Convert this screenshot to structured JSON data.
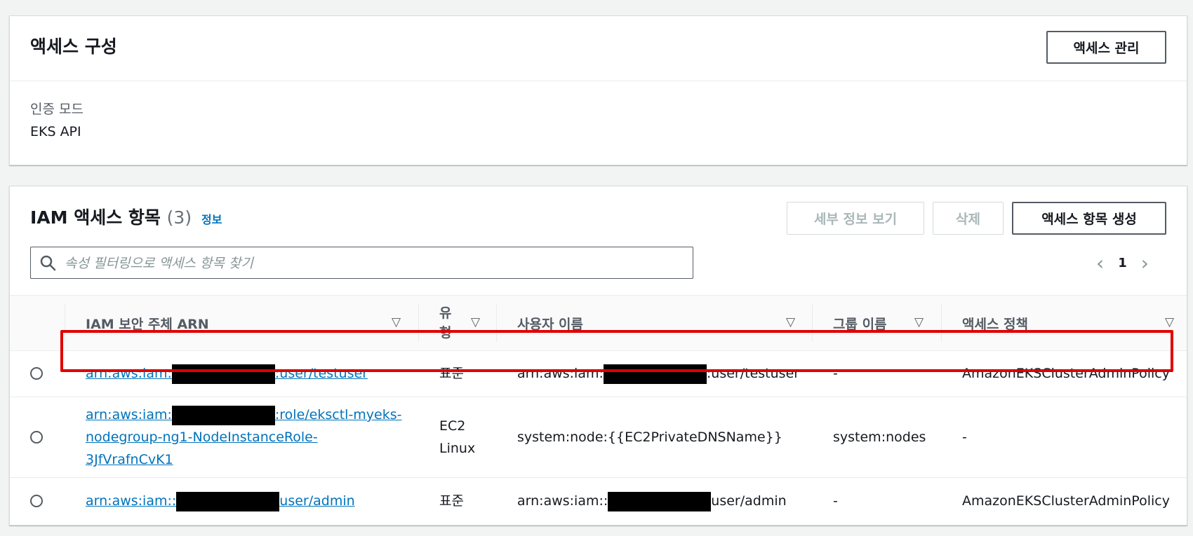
{
  "access_config": {
    "title": "액세스 구성",
    "manage_button": "액세스 관리",
    "auth_mode_label": "인증 모드",
    "auth_mode_value": "EKS API"
  },
  "iam_entries": {
    "title": "IAM 액세스 항목",
    "count": "(3)",
    "info_link": "정보",
    "buttons": {
      "details": "세부 정보 보기",
      "delete": "삭제",
      "create": "액세스 항목 생성"
    },
    "search": {
      "placeholder": "속성 필터링으로 액세스 항목 찾기"
    },
    "pagination": {
      "current_page": "1"
    },
    "columns": {
      "arn": "IAM 보안 주체 ARN",
      "type_line1": "유",
      "type_line2": "형",
      "username": "사용자 이름",
      "group": "그룹 이름",
      "policy": "액세스 정책"
    },
    "rows": [
      {
        "arn_prefix": "arn:aws:iam:",
        "arn_suffix": ":user/testuser",
        "type": "표준",
        "username_prefix": "arn:aws:iam:",
        "username_suffix": ":user/testuser",
        "group": "-",
        "policy": "AmazonEKSClusterAdminPolicy"
      },
      {
        "arn_prefix": "arn:aws:iam:",
        "arn_line1_suffix": ":role/eksctl-myeks-",
        "arn_line2": "nodegroup-ng1-NodeInstanceRole-",
        "arn_line3": "3JfVrafnCvK1",
        "type_line1": "EC2",
        "type_line2": "Linux",
        "username": "system:node:{{EC2PrivateDNSName}}",
        "group": "system:nodes",
        "policy": "-"
      },
      {
        "arn_prefix": "arn:aws:iam::",
        "arn_suffix": "user/admin",
        "type": "표준",
        "username_prefix": "arn:aws:iam::",
        "username_suffix": "user/admin",
        "group": "-",
        "policy": "AmazonEKSClusterAdminPolicy"
      }
    ]
  },
  "colors": {
    "link": "#0073bb",
    "highlight": "#e00000",
    "redaction": "#000000"
  }
}
